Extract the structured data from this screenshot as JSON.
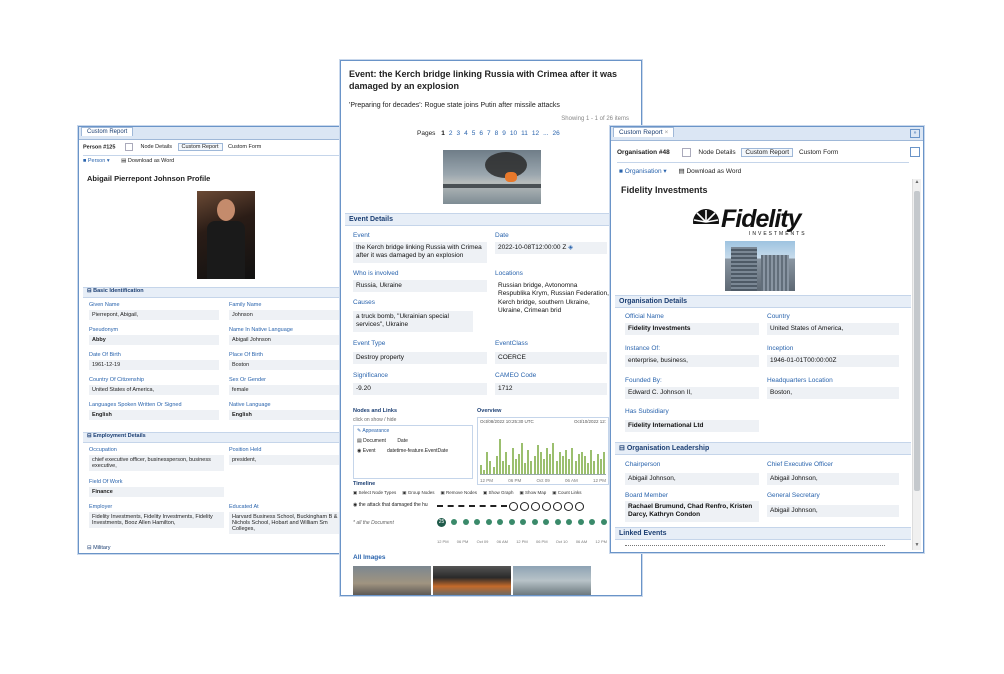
{
  "person": {
    "window_tab": "Custom Report",
    "entity_id": "Person #125",
    "tabs": [
      "Node Details",
      "Custom Report",
      "Custom Form"
    ],
    "toolbar": {
      "type_button": "Person",
      "download_button": "Download as Word"
    },
    "title": "Abigail Pierrepont Johnson Profile",
    "section_basic": "Basic Identification",
    "fields": {
      "given_name_label": "Given Name",
      "given_name": "Pierrepont, Abigail,",
      "family_name_label": "Family Name",
      "family_name": "Johnson",
      "pseudonym_label": "Pseudonym",
      "pseudonym": "Abby",
      "native_name_label": "Name In Native Language",
      "native_name": "Abigail Johnson",
      "dob_label": "Date Of Birth",
      "dob": "1961-12-19",
      "pob_label": "Place Of Birth",
      "pob": "Boston",
      "citizenship_label": "Country Of Citizenship",
      "citizenship": "United States of America,",
      "gender_label": "Sex Or Gender",
      "gender": "female",
      "languages_label": "Languages Spoken Written Or Signed",
      "languages": "English",
      "native_lang_label": "Native Language",
      "native_lang": "English"
    },
    "section_employment": "Employment Details",
    "employment": {
      "occupation_label": "Occupation",
      "occupation": "chief executive officer, businessperson, business executive,",
      "position_label": "Position Held",
      "position": "president,",
      "field_label": "Field Of Work",
      "field": "Finance",
      "employer_label": "Employer",
      "employer": "Fidelity Investments, Fidelity Investments, Fidelity Investments, Booz Allen Hamilton,",
      "educated_label": "Educated At",
      "educated": "Harvard Business School, Buckingham B & Nichols School, Hobart and William Sm Colleges,"
    },
    "section_military": "Military"
  },
  "event": {
    "title": "Event: the Kerch bridge linking Russia with Crimea after it was damaged by an explosion",
    "headline": "'Preparing for decades': Rogue state joins Putin after missile attacks",
    "showing": "Showing 1 - 1 of 26 items",
    "pages_label": "Pages",
    "pages": [
      "1",
      "2",
      "3",
      "4",
      "5",
      "6",
      "7",
      "8",
      "9",
      "10",
      "11",
      "12",
      "...",
      "26"
    ],
    "section_details": "Event Details",
    "event_label": "Event",
    "event_value": "the Kerch bridge linking Russia with Crimea after it was damaged by an explosion",
    "date_label": "Date",
    "date_value": "2022-10-08T12:00:00 Z",
    "who_label": "Who is involved",
    "who_value": "Russia, Ukraine",
    "locations_label": "Locations",
    "locations_value": "Russian bridge, Avtonomna Respublika Krym, Russian Federation, Kerch bridge, southern Ukraine, Ukraine, Crimean brid",
    "causes_label": "Causes",
    "causes_value": "a truck bomb, \"Ukrainian special services\", Ukraine",
    "type_label": "Event Type",
    "type_value": "Destroy property",
    "class_label": "EventClass",
    "class_value": "COERCE",
    "significance_label": "Significance",
    "significance_value": "-9.20",
    "cameo_label": "CAMEO Code",
    "cameo_value": "1712",
    "nodes_title": "Nodes and Links",
    "nodes_hint": "click on show / hide",
    "nodes_items": [
      "Appearance",
      "Document",
      "Event"
    ],
    "nodes_cols": [
      "Date",
      "datetime-feature.EventDate"
    ],
    "overview_title": "Overview",
    "overview_start": "Oct/08/2022 10:25:30 UTC",
    "overview_end": "Oct/10/2022 12:",
    "timeline_title": "Timeline",
    "timeline_tools": [
      "Select Node Types",
      "Group Nodes",
      "Remove Nodes",
      "Show Graph",
      "Show Map",
      "Count Links"
    ],
    "timeline_row1": "the attack that damaged the hu",
    "timeline_row2": "* all the Document",
    "timeline_count": "25",
    "timeline_ticks": [
      "12 PM",
      "06 PM",
      "Oct 09",
      "06 AM",
      "12 PM",
      "06 PM",
      "Oct 10",
      "06 AM",
      "12 PM"
    ],
    "overview_ticks": [
      "12 PM",
      "06 PM",
      "Oct 09",
      "06 AM",
      "12 PM"
    ],
    "overview_bars": [
      0.2,
      0.1,
      0.5,
      0.3,
      0.15,
      0.4,
      0.8,
      0.3,
      0.5,
      0.2,
      0.6,
      0.35,
      0.45,
      0.7,
      0.25,
      0.55,
      0.3,
      0.4,
      0.65,
      0.5,
      0.35,
      0.6,
      0.45,
      0.7,
      0.3,
      0.5,
      0.4,
      0.55,
      0.35,
      0.6,
      0.3,
      0.45,
      0.5,
      0.4,
      0.25,
      0.55,
      0.3,
      0.45,
      0.35,
      0.5
    ],
    "images_title": "All Images"
  },
  "org": {
    "window_tab": "Custom Report",
    "entity_id": "Organisation #48",
    "tabs": [
      "Node Details",
      "Custom Report",
      "Custom Form"
    ],
    "toolbar": {
      "type_button": "Organisation",
      "download_button": "Download as Word"
    },
    "title": "Fidelity Investments",
    "logo_word": "Fidelity",
    "logo_sub": "INVESTMENTS",
    "section_details": "Organisation Details",
    "official_name_label": "Official Name",
    "official_name": "Fidelity Investments",
    "country_label": "Country",
    "country": "United States of America,",
    "instance_label": "Instance Of:",
    "instance": "enterprise, business,",
    "inception_label": "Inception",
    "inception": "1946-01-01T00:00:00Z",
    "founded_label": "Founded By:",
    "founded": "Edward C. Johnson II,",
    "hq_label": "Headquarters Location",
    "hq": "Boston,",
    "subsidiary_label": "Has Subsidiary",
    "subsidiary": "Fidelity International Ltd",
    "section_leadership": "Organisation Leadership",
    "chair_label": "Chairperson",
    "chair": "Abigail Johnson,",
    "ceo_label": "Chief Executive Officer",
    "ceo": "Abigail Johnson,",
    "board_label": "Board Member",
    "board": "Rachael Brumund, Chad Renfro, Kristen Darcy, Kathryn Condon",
    "gensec_label": "General Secretary",
    "gensec": "Abigail Johnson,",
    "section_linked": "Linked Events"
  },
  "colors": {
    "accent": "#2a64ad",
    "border": "#6a94c8",
    "value_bg": "#eef1f5",
    "timeline_green": "#3a8a6a"
  }
}
